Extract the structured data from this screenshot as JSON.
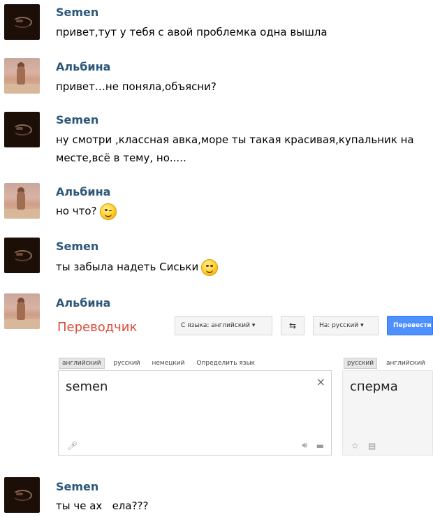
{
  "messages": [
    {
      "sender": "Semen",
      "text": "привет,тут у тебя с авой проблемка одна вышла"
    },
    {
      "sender": "Альбина",
      "text": "привет…не поняла,объясни?"
    },
    {
      "sender": "Semen",
      "text_line1": "ну смотри ,классная авка,море ты такая красивая,купальник на",
      "text_line2": "месте,всё в тему, но....."
    },
    {
      "sender": "Альбина",
      "text": "но что?"
    },
    {
      "sender": "Semen",
      "text": "ты забыла надеть Сиськи"
    },
    {
      "sender": "Альбина"
    },
    {
      "sender": "Semen",
      "text": "ты че ах   ела???"
    }
  ],
  "translator": {
    "title": "Переводчик",
    "from_button": "С языка: английский",
    "to_button": "На: русский",
    "translate_button": "Перевести",
    "source_tabs": [
      "английский",
      "русский",
      "немецкий",
      "Определить язык"
    ],
    "target_tabs": [
      "русский",
      "английский"
    ],
    "source_text": "semen",
    "target_text": "сперма",
    "clear_symbol": "×"
  },
  "colors": {
    "name": "#2b587a",
    "title": "#dd4b39",
    "blue_button": "#4d90fe"
  }
}
